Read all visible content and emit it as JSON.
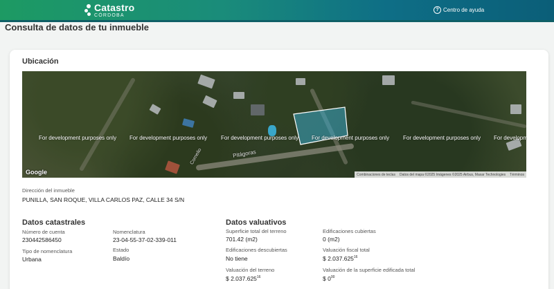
{
  "header": {
    "logo_title": "Catastro",
    "logo_subtitle": "CÓRDOBA",
    "help_label": "Centro de ayuda",
    "help_icon": "question-circle-icon"
  },
  "page_title": "Consulta de datos de tu inmueble",
  "ubicacion": {
    "title": "Ubicación",
    "map": {
      "watermark": "For development purposes only",
      "streets": [
        "Pitágoras",
        "Cornelio"
      ],
      "google_label": "Google",
      "attribution": {
        "shortcuts": "Combinaciones de teclas",
        "data": "Datos del mapa ©2025 Imágenes ©2025 Airbus, Maxar Technologies",
        "terms": "Términos"
      },
      "parcel_color": "#3aa8c8"
    },
    "address_label": "Dirección del inmueble",
    "address_value": "PUNILLA, SAN ROQUE, VILLA CARLOS PAZ, CALLE 34 S/N"
  },
  "catastrales": {
    "title": "Datos catastrales",
    "cuenta_label": "Número de cuenta",
    "cuenta_value": "230442586450",
    "nomenclatura_label": "Nomenclatura",
    "nomenclatura_value": "23-04-55-37-02-339-011",
    "tipo_label": "Tipo de nomenclatura",
    "tipo_value": "Urbana",
    "estado_label": "Estado",
    "estado_value": "Baldío"
  },
  "valuativos": {
    "title": "Datos valuativos",
    "superficie_label": "Superficie total del terreno",
    "superficie_value": "701.42 (m2)",
    "cubiertas_label": "Edificaciones cubiertas",
    "cubiertas_value": "0 (m2)",
    "descubiertas_label": "Edificaciones descubiertas",
    "descubiertas_value": "No tiene",
    "fiscal_label": "Valuación fiscal total",
    "fiscal_value": "$ 2.037.625",
    "fiscal_cents": "16",
    "terreno_label": "Valuación del terreno",
    "terreno_value": "$ 2.037.625",
    "terreno_cents": "16",
    "edificada_label": "Valuación de la superficie edificada total",
    "edificada_value": "$ 0",
    "edificada_cents": "00"
  }
}
